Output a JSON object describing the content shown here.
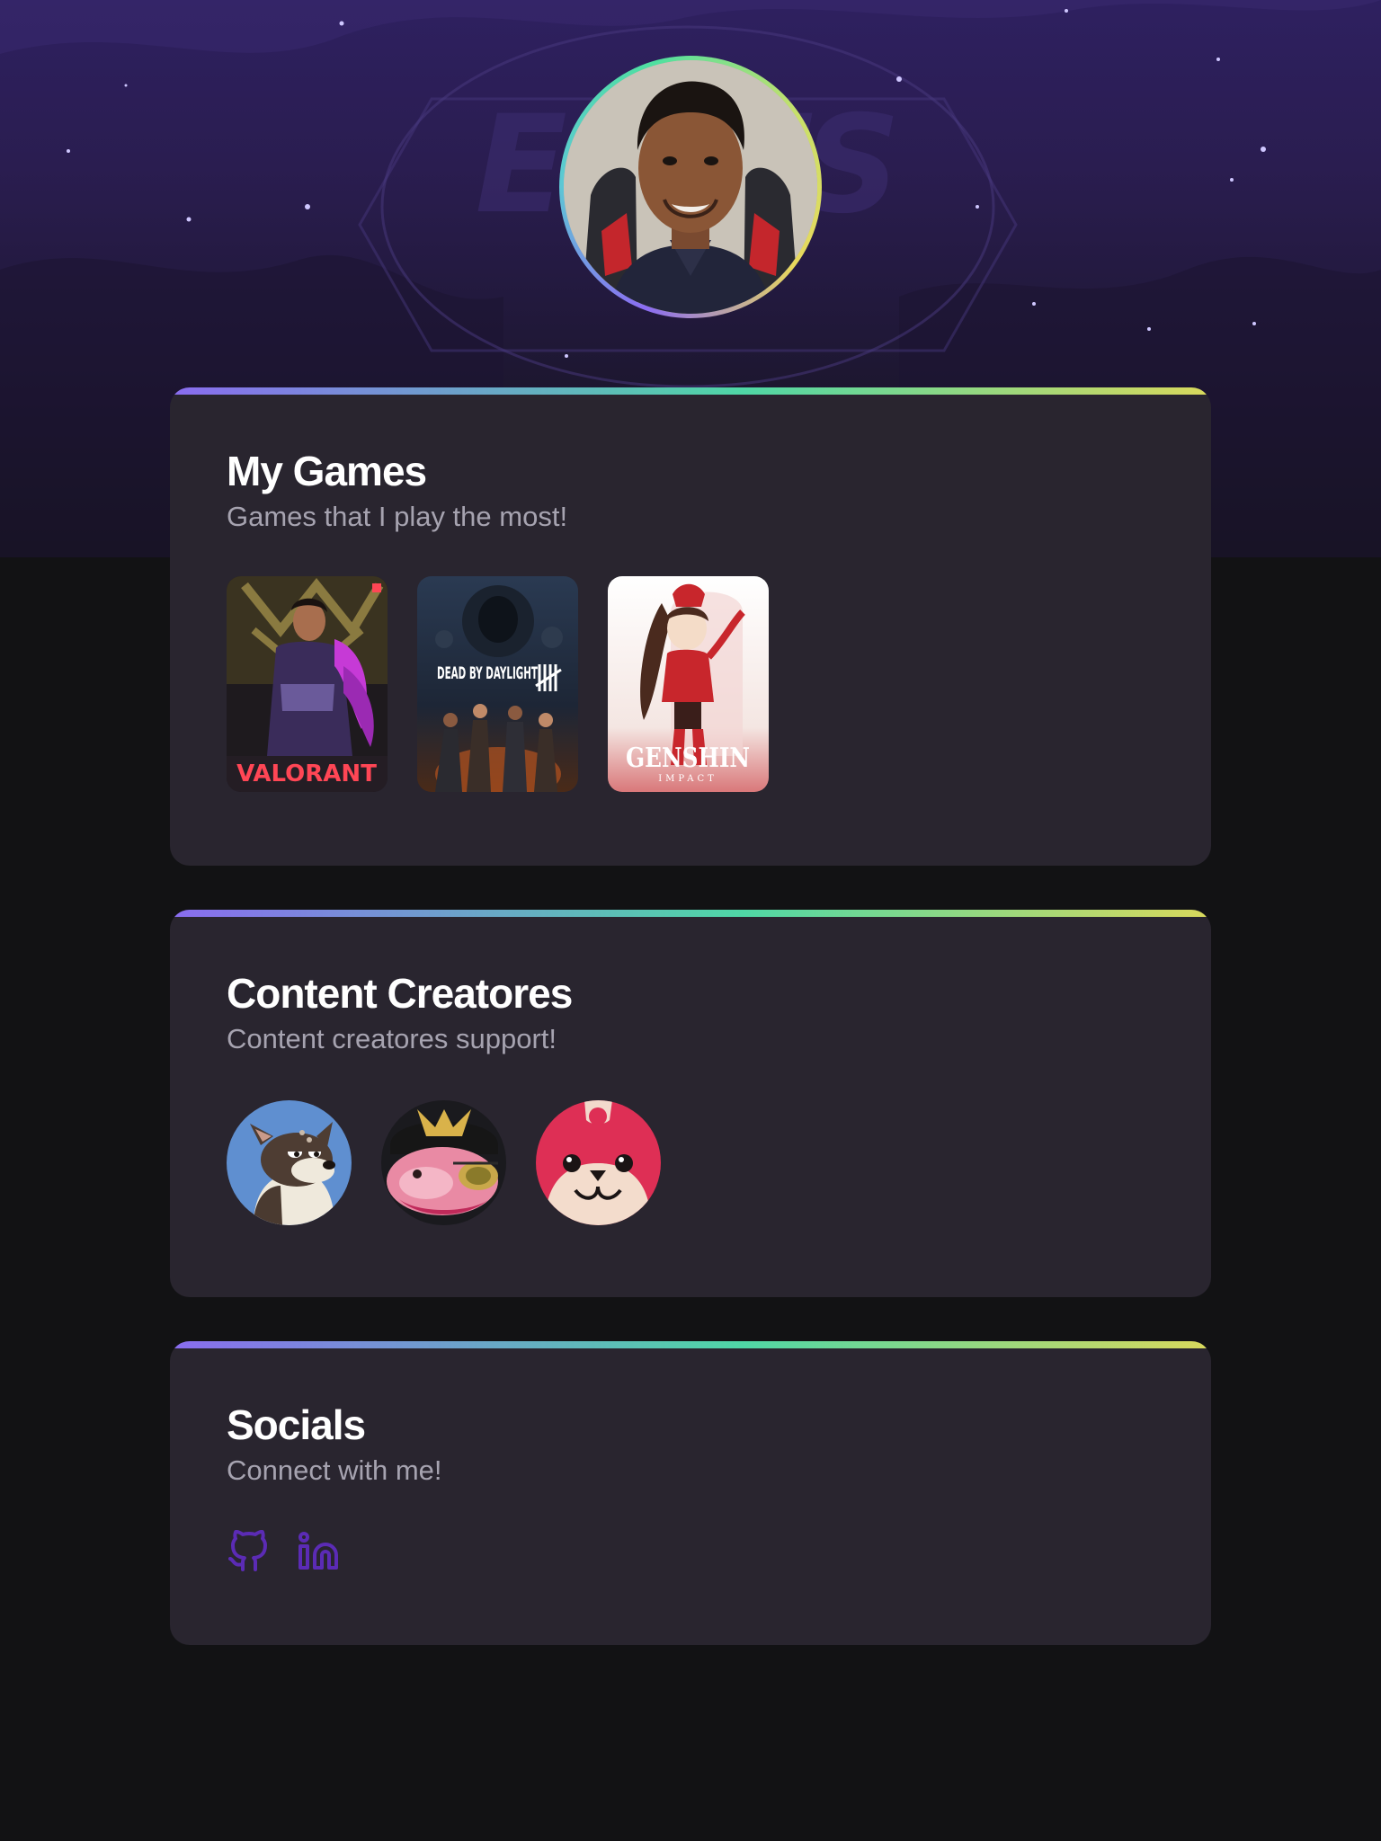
{
  "profile": {
    "avatar_alt": "Profile photo"
  },
  "games_section": {
    "title": "My Games",
    "subtitle": "Games that I play the most!",
    "games": [
      {
        "name": "VALORANT"
      },
      {
        "name": "DEAD BY DAYLIGHT"
      },
      {
        "name": "GENSHIN",
        "sub": "IMPACT"
      }
    ]
  },
  "creators_section": {
    "title": "Content Creatores",
    "subtitle": "Content creatores support!",
    "creators": [
      {
        "icon": "dog-avatar-icon"
      },
      {
        "icon": "pirate-avatar-icon"
      },
      {
        "icon": "red-mascot-avatar-icon"
      }
    ]
  },
  "socials_section": {
    "title": "Socials",
    "subtitle": "Connect with me!",
    "links": [
      {
        "icon": "github-icon",
        "color": "#5b2bb5"
      },
      {
        "icon": "linkedin-icon",
        "color": "#5b2bb5"
      }
    ]
  },
  "colors": {
    "background": "#121214",
    "card": "#29252f",
    "accent_gradient": [
      "#8a6cf0",
      "#4fd7a6",
      "#d9d95c"
    ],
    "subtitle": "#a6a3b0"
  }
}
